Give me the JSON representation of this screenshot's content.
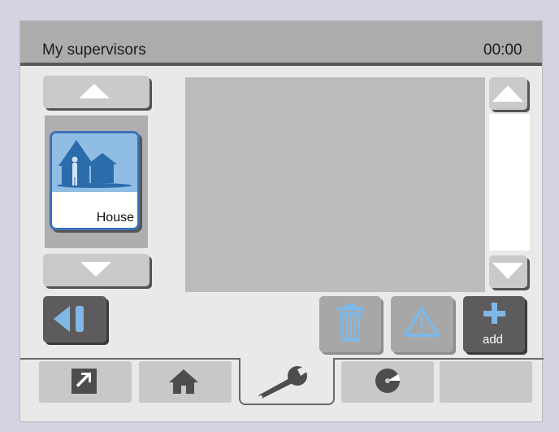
{
  "header": {
    "title": "My supervisors",
    "clock": "00:00"
  },
  "list": {
    "items": [
      {
        "label": "House",
        "icon": "house-person-icon"
      }
    ]
  },
  "toolbar": {
    "add_label": "add"
  },
  "tabs": [
    {
      "icon": "external-link-icon"
    },
    {
      "icon": "home-icon"
    },
    {
      "icon": "wrench-icon",
      "active": true
    },
    {
      "icon": "disc-icon"
    },
    {
      "icon": ""
    }
  ],
  "colors": {
    "accent": "#3d6fb6",
    "icon_blue": "#7fb8e6",
    "header_bg": "#aeabab",
    "panel_bg": "#eae8e8"
  }
}
